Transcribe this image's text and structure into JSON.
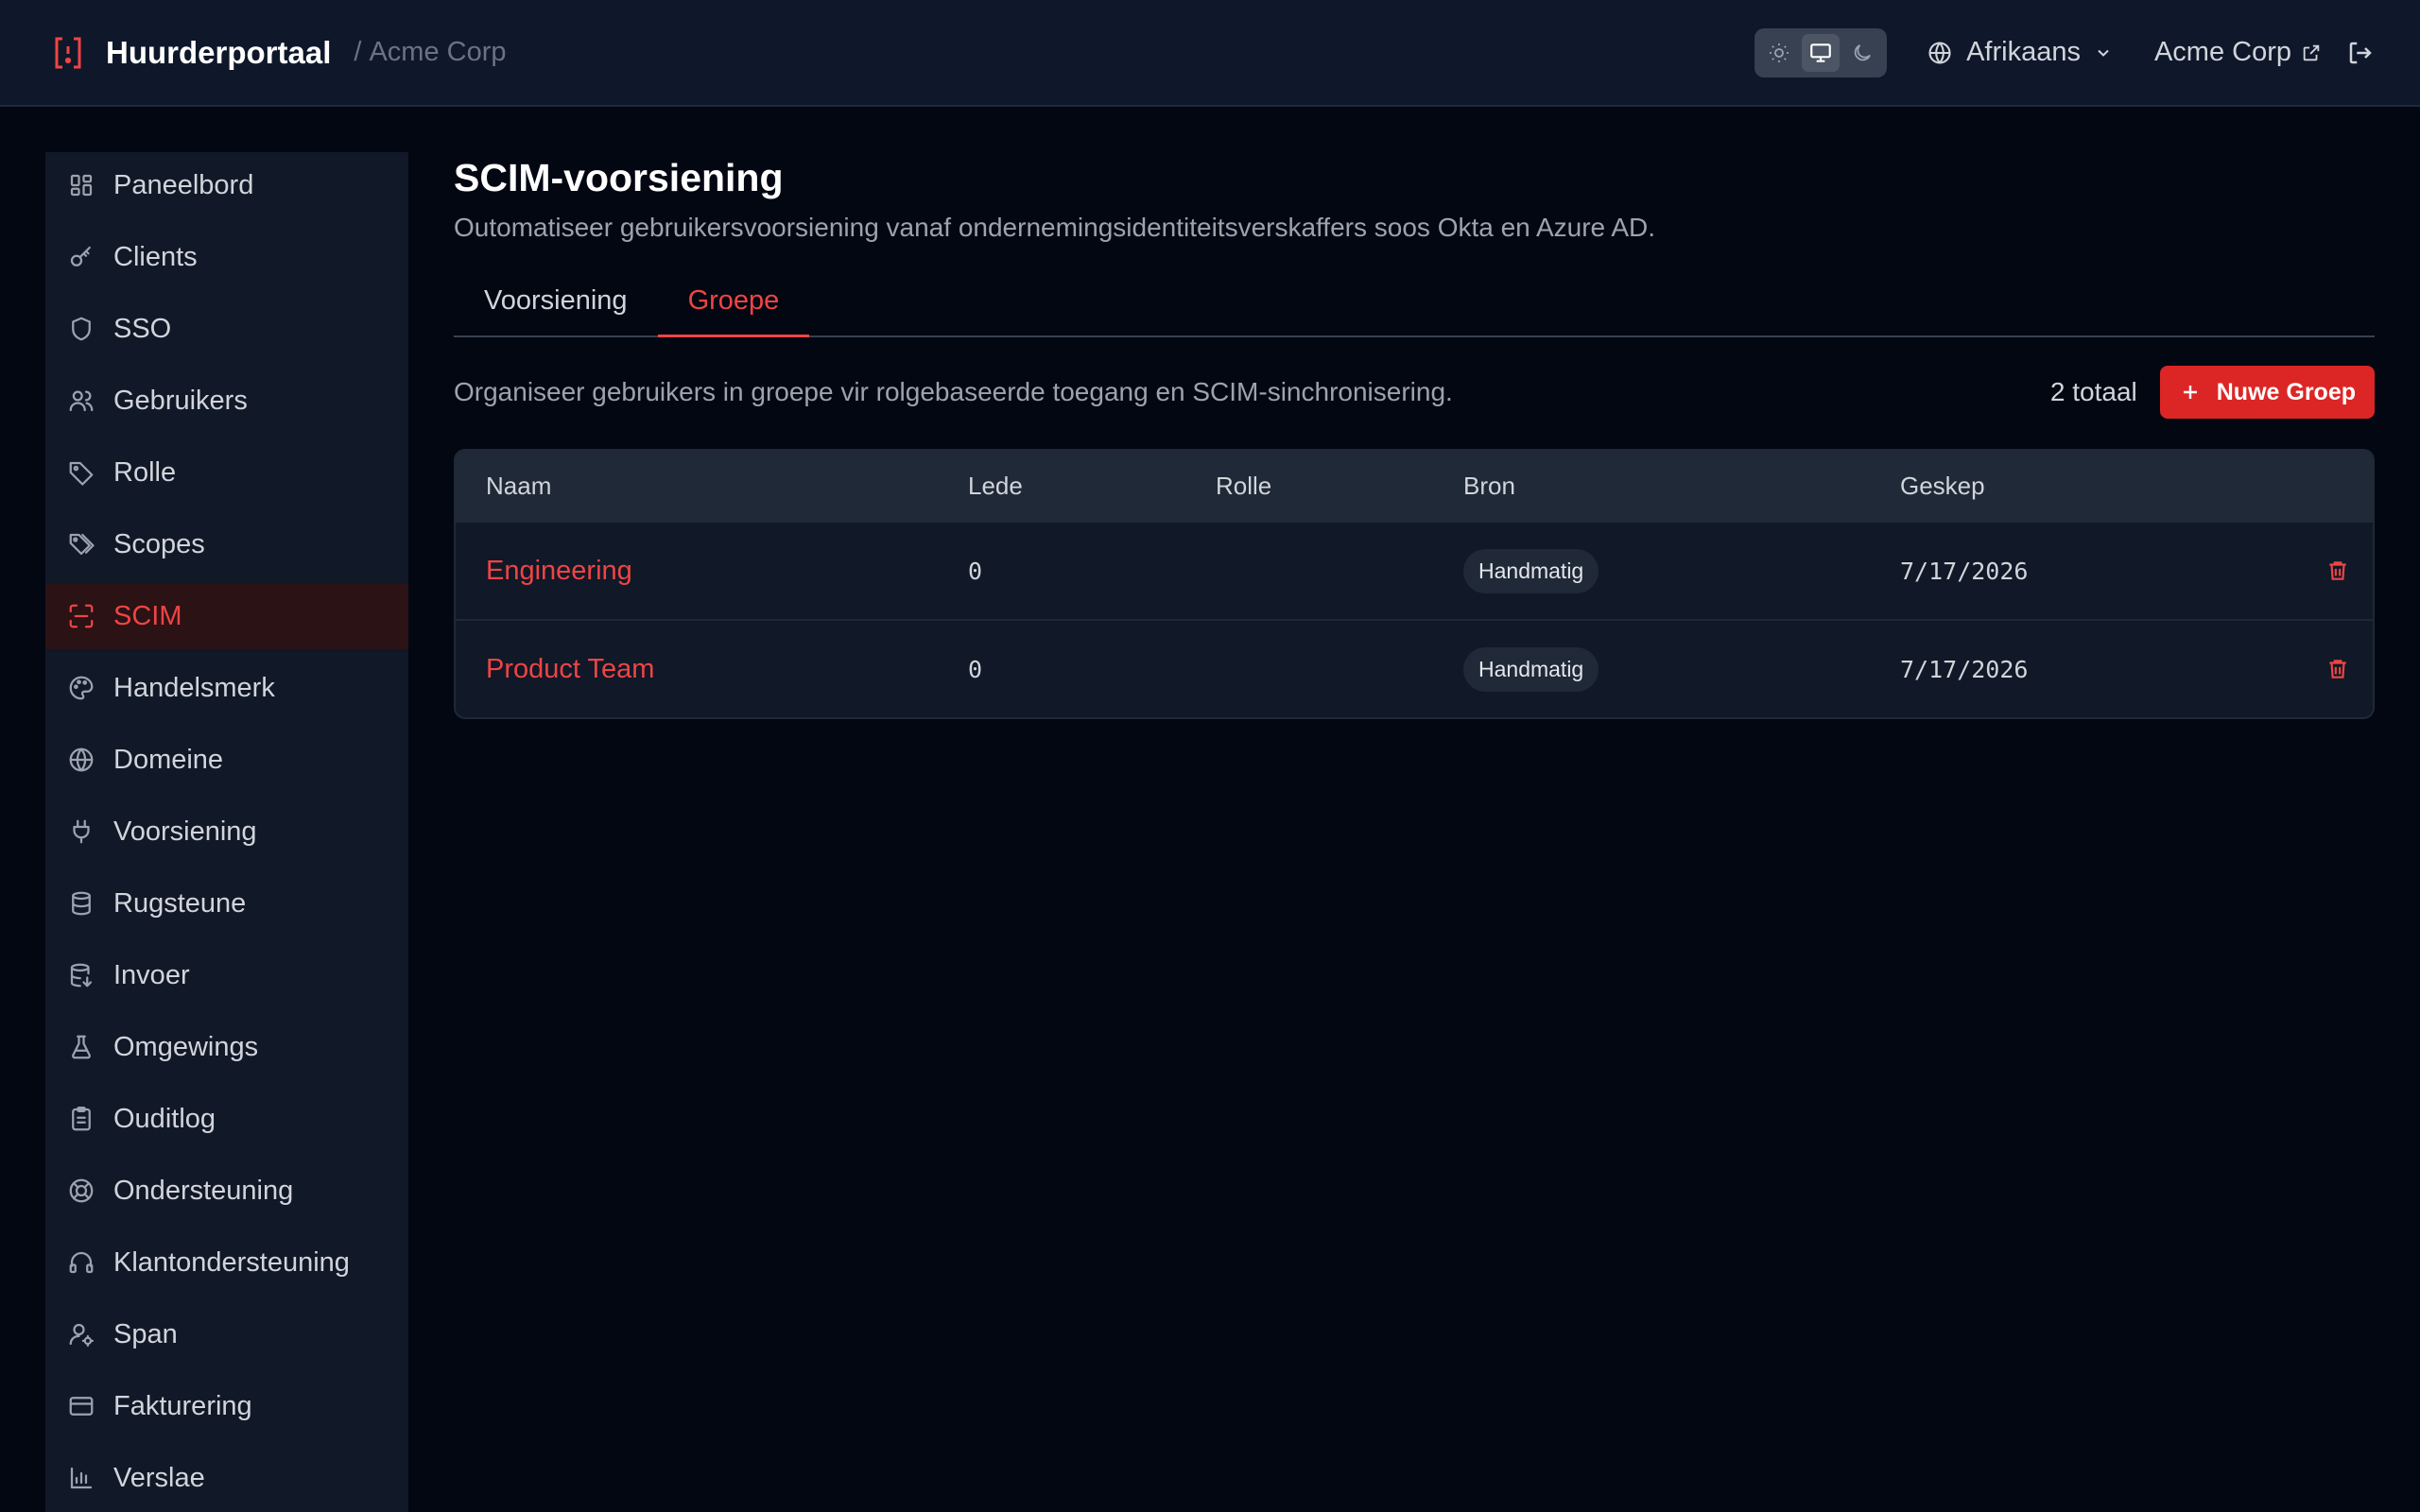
{
  "header": {
    "brand": "Huurderportaal",
    "separator": "/",
    "tenant_crumb": "Acme Corp",
    "language": "Afrikaans",
    "tenant_link": "Acme Corp"
  },
  "sidebar": {
    "items": [
      {
        "label": "Paneelbord",
        "icon": "dashboard-icon"
      },
      {
        "label": "Clients",
        "icon": "key-icon"
      },
      {
        "label": "SSO",
        "icon": "shield-icon"
      },
      {
        "label": "Gebruikers",
        "icon": "users-icon"
      },
      {
        "label": "Rolle",
        "icon": "tag-icon"
      },
      {
        "label": "Scopes",
        "icon": "tags-icon"
      },
      {
        "label": "SCIM",
        "icon": "scan-icon"
      },
      {
        "label": "Handelsmerk",
        "icon": "palette-icon"
      },
      {
        "label": "Domeine",
        "icon": "globe-icon"
      },
      {
        "label": "Voorsiening",
        "icon": "plug-icon"
      },
      {
        "label": "Rugsteune",
        "icon": "database-icon"
      },
      {
        "label": "Invoer",
        "icon": "database-import-icon"
      },
      {
        "label": "Omgewings",
        "icon": "flask-icon"
      },
      {
        "label": "Ouditlog",
        "icon": "clipboard-icon"
      },
      {
        "label": "Ondersteuning",
        "icon": "lifebuoy-icon"
      },
      {
        "label": "Klantondersteuning",
        "icon": "headset-icon"
      },
      {
        "label": "Span",
        "icon": "user-cog-icon"
      },
      {
        "label": "Fakturering",
        "icon": "credit-card-icon"
      },
      {
        "label": "Verslae",
        "icon": "bar-chart-icon"
      }
    ],
    "active_index": 6
  },
  "main": {
    "title": "SCIM-voorsiening",
    "subtitle": "Outomatiseer gebruikersvoorsiening vanaf ondernemingsidentiteitsverskaffers soos Okta en Azure AD.",
    "tabs": [
      {
        "label": "Voorsiening"
      },
      {
        "label": "Groepe"
      }
    ],
    "active_tab": 1,
    "toolbar": {
      "description": "Organiseer gebruikers in groepe vir rolgebaseerde toegang en SCIM-sinchronisering.",
      "total": "2 totaal",
      "new_button": "Nuwe Groep"
    },
    "table": {
      "headers": [
        "Naam",
        "Lede",
        "Rolle",
        "Bron",
        "Geskep"
      ],
      "rows": [
        {
          "name": "Engineering",
          "members": "0",
          "roles": "",
          "source": "Handmatig",
          "created": "7/17/2026"
        },
        {
          "name": "Product Team",
          "members": "0",
          "roles": "",
          "source": "Handmatig",
          "created": "7/17/2026"
        }
      ]
    }
  },
  "colors": {
    "accent": "#ef4444",
    "primary_button": "#dc2626",
    "background": "#030712",
    "panel": "#111827"
  }
}
